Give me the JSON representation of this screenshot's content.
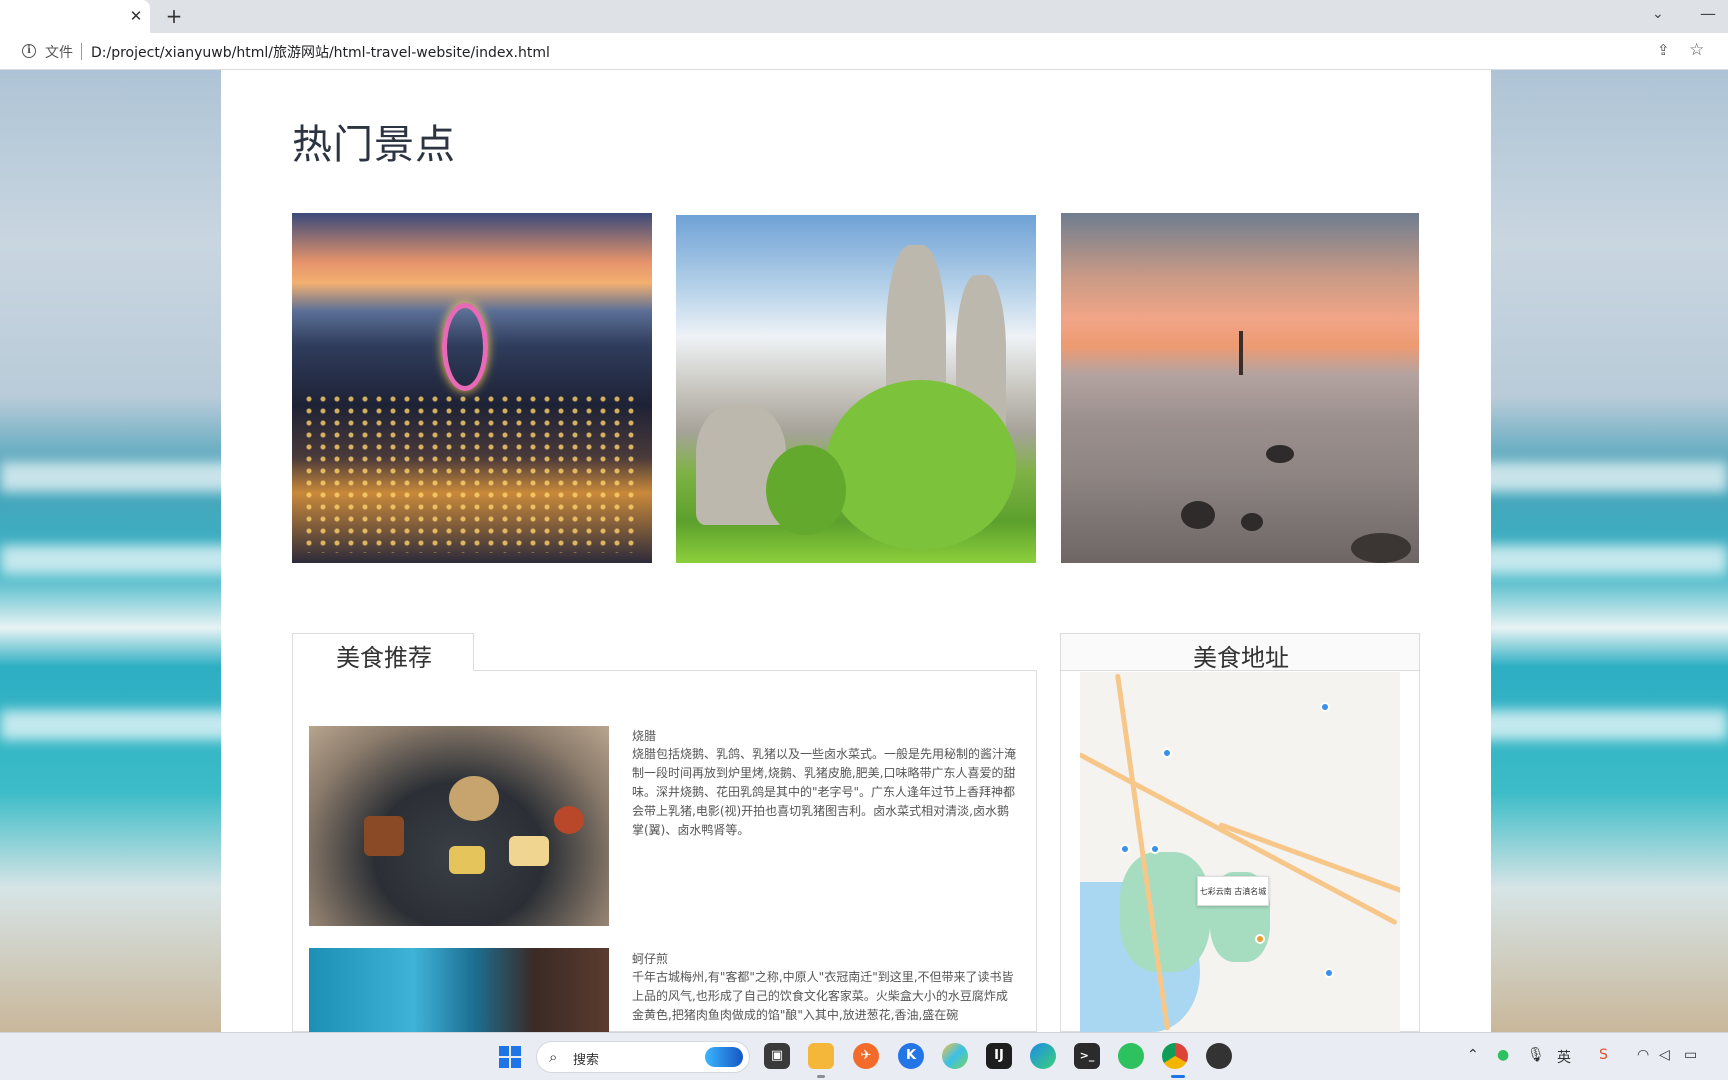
{
  "browser": {
    "new_tab_label": "+",
    "close_tab_label": "✕",
    "tab_dropdown": "⌄",
    "minimize": "—",
    "scheme_label": "文件",
    "url": "D:/project/xianyuwb/html/旅游网站/html-travel-website/index.html"
  },
  "page": {
    "title": "热门景点",
    "attractions": [
      {
        "name": "attraction-photo-1",
        "icon": "night-park-ferris-wheel"
      },
      {
        "name": "attraction-photo-2",
        "icon": "stone-forest"
      },
      {
        "name": "attraction-photo-3",
        "icon": "lake-sunset"
      }
    ],
    "food_section": {
      "tab_label": "美食推荐",
      "dishes": [
        {
          "title": "烧腊",
          "description": "烧腊包括烧鹅、乳鸽、乳猪以及一些卤水菜式。一般是先用秘制的酱汁淹制一段时间再放到炉里烤,烧鹅、乳猪皮脆,肥美,口味略带广东人喜爱的甜味。深井烧鹅、花田乳鸽是其中的\"老字号\"。广东人逢年过节上香拜神都会带上乳猪,电影(视)开拍也喜切乳猪图吉利。卤水菜式相对清淡,卤水鹅掌(翼)、卤水鸭肾等。"
        },
        {
          "title": "蚵仔煎",
          "description": "千年古城梅州,有\"客都\"之称,中原人\"衣冠南迁\"到这里,不但带来了读书皆上品的风气,也形成了自己的饮食文化客家菜。火柴盒大小的水豆腐炸成金黄色,把猪肉鱼肉做成的馅\"酿\"入其中,放进葱花,香油,盛在碗"
        }
      ]
    },
    "map_section": {
      "tab_label": "美食地址",
      "popup_label": "七彩云南 古滇名城"
    }
  },
  "taskbar": {
    "search_label": "搜索",
    "apps": [
      "file-explorer",
      "postman",
      "kugou",
      "colorful-app",
      "jetbrains",
      "edge",
      "terminal",
      "wechat",
      "chrome",
      "obs"
    ]
  },
  "colors": {
    "accent_blue": "#1f74e8",
    "title_text": "#2c3442"
  }
}
